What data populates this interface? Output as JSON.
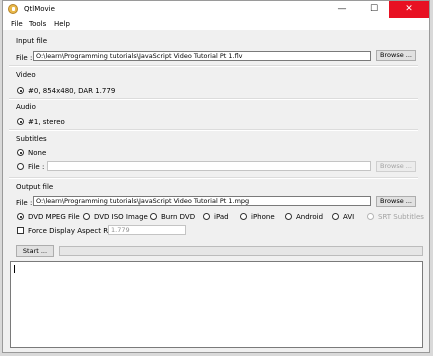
{
  "window": {
    "title": "QtlMovie",
    "icon": "qtlmovie-app-icon"
  },
  "caption": {
    "minimize": "—",
    "maximize": "☐",
    "close": "✕"
  },
  "menu": {
    "file": "File",
    "tools": "Tools",
    "help": "Help"
  },
  "input": {
    "heading": "Input file",
    "file_label": "File :",
    "file_value": "O:\\learn\\Programming tutorials\\JavaScript Video Tutorial Pt 1.flv",
    "browse": "Browse ..."
  },
  "video": {
    "heading": "Video",
    "stream": "#0, 854x480, DAR 1.779",
    "selected": true
  },
  "audio": {
    "heading": "Audio",
    "stream": "#1, stereo",
    "selected": true
  },
  "subtitles": {
    "heading": "Subtitles",
    "none_label": "None",
    "file_label": "File :",
    "file_value": "",
    "browse": "Browse ...",
    "selected": "none"
  },
  "output": {
    "heading": "Output file",
    "file_label": "File :",
    "file_value": "O:\\learn\\Programming tutorials\\JavaScript Video Tutorial Pt 1.mpg",
    "browse": "Browse ...",
    "formats": {
      "dvd_mpeg": "DVD MPEG File",
      "dvd_iso": "DVD ISO Image",
      "burn_dvd": "Burn DVD",
      "ipad": "iPad",
      "iphone": "iPhone",
      "android": "Android",
      "avi": "AVI",
      "srt": "SRT Subtitles"
    },
    "selected_format": "dvd_mpeg",
    "force_aspect_label": "Force Display Aspect Ratio :",
    "force_aspect_checked": false,
    "aspect_value": "1.779"
  },
  "actions": {
    "start": "Start ...",
    "progress": 0
  },
  "log": {
    "text": ""
  }
}
